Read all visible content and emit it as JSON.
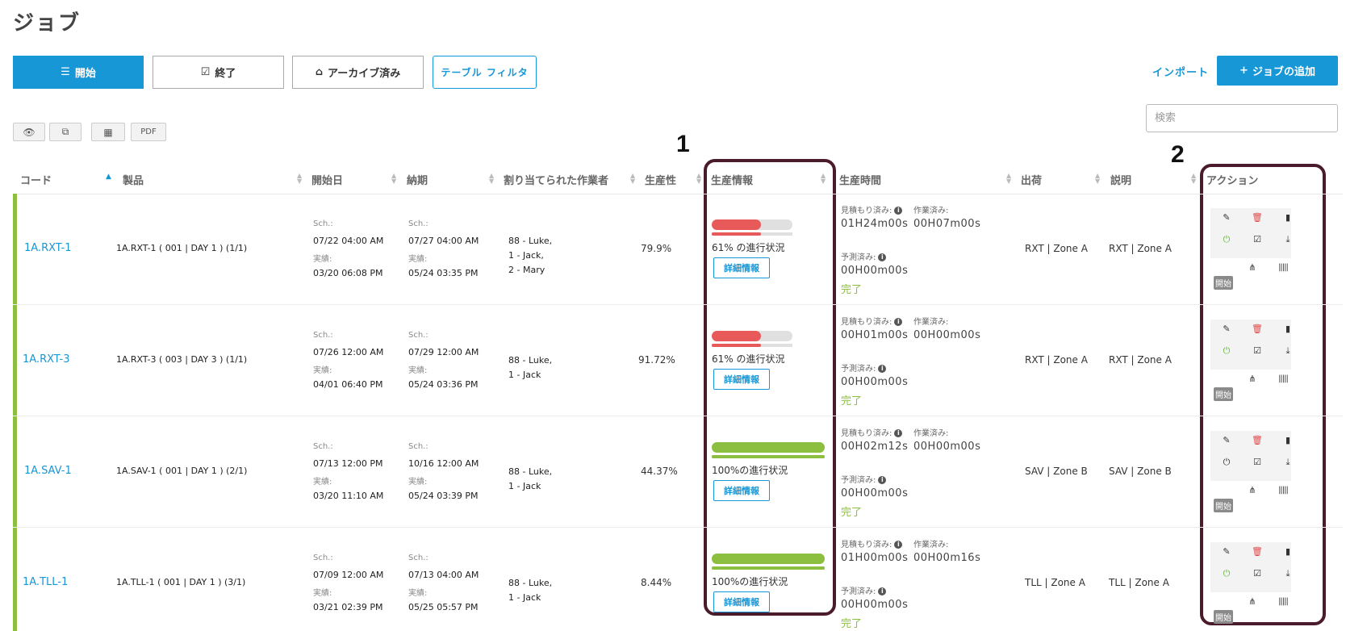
{
  "page_title": "ジョブ",
  "tabs": {
    "start": "開始",
    "done": "終了",
    "archived": "アーカイブ済み",
    "filter": "テーブル フィルタ"
  },
  "header_actions": {
    "import": "インポート",
    "add_job": "ジョブの追加"
  },
  "search": {
    "placeholder": "検索"
  },
  "toolbar": {
    "pdf": "PDF"
  },
  "annotations": {
    "one": "1",
    "two": "2"
  },
  "columns": {
    "code": "コード",
    "product": "製品",
    "start_date": "開始日",
    "due_date": "納期",
    "workers": "割り当てられた作業者",
    "productivity": "生産性",
    "production_info": "生産情報",
    "production_time": "生産時間",
    "shipping": "出荷",
    "description": "説明",
    "actions": "アクション"
  },
  "labels": {
    "sch": "Sch.:",
    "actual": "実績:",
    "estimate": "見積もり済み:",
    "worked": "作業済み:",
    "predicted": "予測済み:",
    "details": "詳細情報",
    "progress_suffix": "の進行状況"
  },
  "colors": {
    "accent": "#1797d6",
    "row_status": "#8cbf3f",
    "progress_partial": "#e85a5a",
    "progress_full": "#8cbf3f",
    "highlight_border": "#4a1b2c"
  },
  "rows": [
    {
      "code": "1A.RXT-1",
      "product": "1A.RXT-1 ( 001 | DAY 1 ) (1/1)",
      "start_sch": "07/22   04:00 AM",
      "start_act": "03/20   06:08 PM",
      "due_sch": "07/27   04:00 AM",
      "due_act": "05/24   03:35 PM",
      "workers": [
        "88 - Luke,",
        "1 - Jack,",
        "2 - Mary"
      ],
      "productivity": "79.9%",
      "progress": 0.61,
      "progress_text": "61% の進行状況",
      "estimate": "01H24m00s",
      "worked": "00H07m00s",
      "predicted": "00H00m00s",
      "status_text": "完了",
      "shipping": "RXT | Zone A",
      "description": "RXT | Zone A",
      "badge": "開始"
    },
    {
      "code": "1A.RXT-3",
      "product": "1A.RXT-3 ( 003 | DAY 3 ) (1/1)",
      "start_sch": "07/26   12:00 AM",
      "start_act": "04/01   06:40 PM",
      "due_sch": "07/29   12:00 AM",
      "due_act": "05/24   03:36 PM",
      "workers": [
        "88 - Luke,",
        "1 - Jack"
      ],
      "productivity": "91.72%",
      "progress": 0.61,
      "progress_text": "61% の進行状況",
      "estimate": "00H01m00s",
      "worked": "00H00m00s",
      "predicted": "00H00m00s",
      "status_text": "完了",
      "shipping": "RXT | Zone A",
      "description": "RXT | Zone A",
      "badge": "開始"
    },
    {
      "code": "1A.SAV-1",
      "product": "1A.SAV-1 ( 001 | DAY 1 ) (2/1)",
      "start_sch": "07/13   12:00 PM",
      "start_act": "03/20   11:10 AM",
      "due_sch": "10/16   12:00 AM",
      "due_act": "05/24   03:39 PM",
      "workers": [
        "88 - Luke,",
        "1 - Jack"
      ],
      "productivity": "44.37%",
      "progress": 1.0,
      "progress_text": "100%の進行状況",
      "estimate": "00H02m12s",
      "worked": "00H00m00s",
      "predicted": "00H00m00s",
      "status_text": "完了",
      "shipping": "SAV | Zone B",
      "description": "SAV | Zone B",
      "badge": "開始"
    },
    {
      "code": "1A.TLL-1",
      "product": "1A.TLL-1 ( 001 | DAY 1 ) (3/1)",
      "start_sch": "07/09   12:00 AM",
      "start_act": "03/21   02:39 PM",
      "due_sch": "07/13   04:00 AM",
      "due_act": "05/25   05:57 PM",
      "workers": [
        "88 - Luke,",
        "1 - Jack"
      ],
      "productivity": "8.44%",
      "progress": 1.0,
      "progress_text": "100%の進行状況",
      "estimate": "01H00m00s",
      "worked": "00H00m16s",
      "predicted": "00H00m00s",
      "status_text": "完了",
      "shipping": "TLL | Zone A",
      "description": "TLL | Zone A",
      "badge": "開始"
    }
  ]
}
